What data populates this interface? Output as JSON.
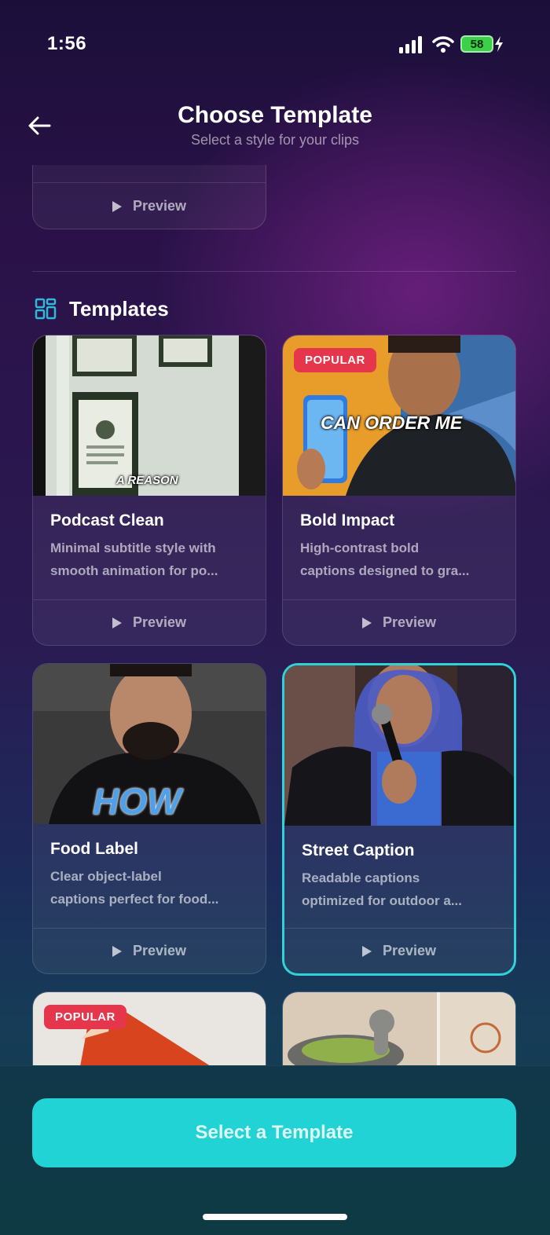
{
  "status_bar": {
    "time": "1:56",
    "battery": "58"
  },
  "header": {
    "title": "Choose Template",
    "subtitle": "Select a style for your clips"
  },
  "partial_card": {
    "preview_label": "Preview"
  },
  "section": {
    "title": "Templates",
    "icon": "grid-icon"
  },
  "templates": [
    {
      "name": "Podcast Clean",
      "desc_line1": "Minimal subtitle style with",
      "desc_line2": "smooth animation for po...",
      "preview_label": "Preview",
      "caption": "A REASON",
      "badge": ""
    },
    {
      "name": "Bold Impact",
      "desc_line1": "High-contrast bold",
      "desc_line2": "captions designed to gra...",
      "preview_label": "Preview",
      "caption": "CAN ORDER ME",
      "badge": "POPULAR"
    },
    {
      "name": "Food Label",
      "desc_line1": "Clear object-label",
      "desc_line2": "captions perfect for food...",
      "preview_label": "Preview",
      "caption": "HOW",
      "badge": ""
    },
    {
      "name": "Street Caption",
      "desc_line1": "Readable captions",
      "desc_line2": "optimized for outdoor a...",
      "preview_label": "Preview",
      "caption": "",
      "badge": "",
      "selected": true
    },
    {
      "name": "",
      "badge": "POPULAR"
    },
    {
      "name": "",
      "badge": ""
    }
  ],
  "bottom": {
    "button_label": "Select a Template"
  },
  "colors": {
    "accent": "#22d3d5",
    "badge": "#e6364c",
    "selected_border": "#2fd2d8"
  }
}
